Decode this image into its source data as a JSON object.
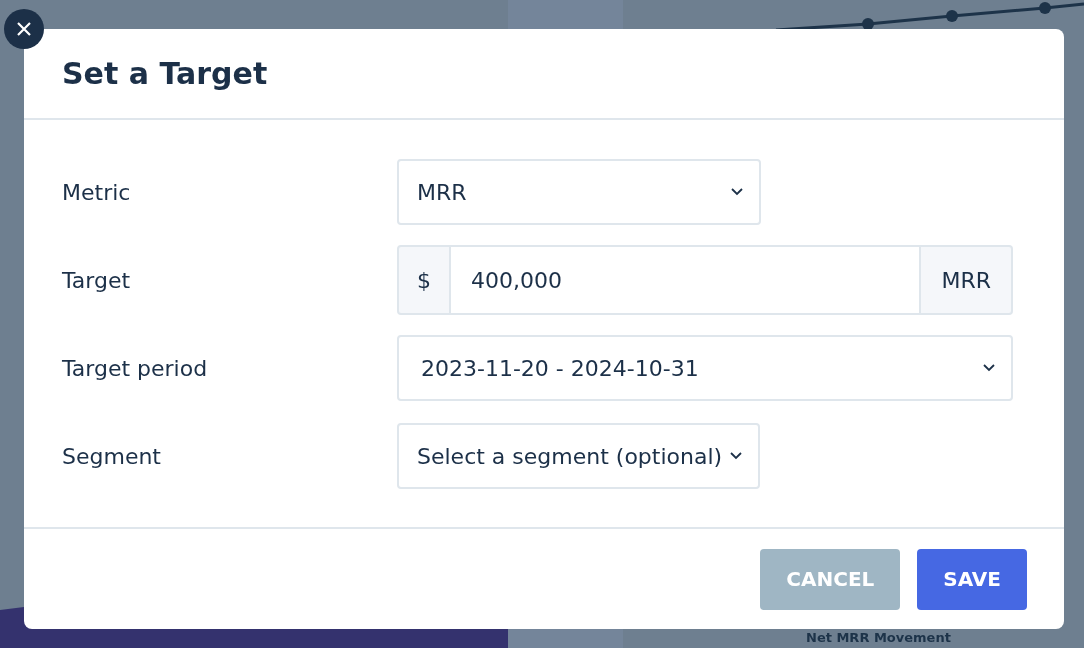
{
  "background": {
    "heading": "Net MRR Movement"
  },
  "dialog": {
    "title": "Set a Target",
    "fields": [
      {
        "kind": "select",
        "label": "Metric",
        "value": "MRR"
      },
      {
        "kind": "money",
        "label": "Target",
        "prefix": "$",
        "value": "400,000",
        "suffix": "MRR"
      },
      {
        "kind": "wide-select",
        "label": "Target period",
        "value": "2023-11-20 - 2024-10-31"
      },
      {
        "kind": "select",
        "label": "Segment",
        "value": "Select a segment (optional)"
      }
    ],
    "buttons": [
      {
        "label": "CANCEL",
        "kind": "secondary"
      },
      {
        "label": "SAVE",
        "kind": "primary"
      }
    ]
  }
}
